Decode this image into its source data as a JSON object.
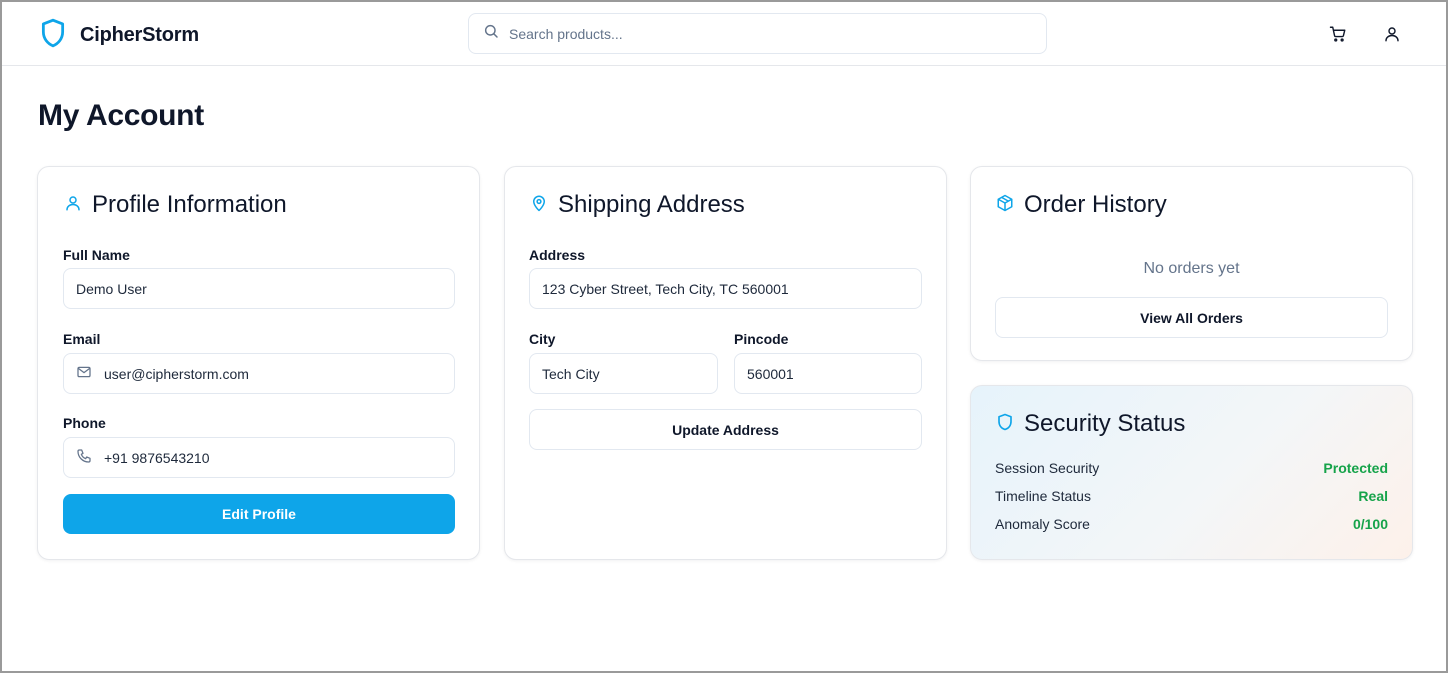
{
  "colors": {
    "accent": "#0ea5e9",
    "success": "#16a34a",
    "text": "#0f172a",
    "muted": "#64748b"
  },
  "header": {
    "brand_name": "CipherStorm",
    "brand_icon": "shield-icon",
    "search_placeholder": "Search products...",
    "cart_icon": "cart-icon",
    "user_icon": "user-icon"
  },
  "page": {
    "title": "My Account"
  },
  "profile": {
    "title": "Profile Information",
    "icon": "user-icon",
    "full_name_label": "Full Name",
    "full_name_value": "Demo User",
    "email_label": "Email",
    "email_value": "user@cipherstorm.com",
    "phone_label": "Phone",
    "phone_value": "+91 9876543210",
    "edit_button": "Edit Profile"
  },
  "shipping": {
    "title": "Shipping Address",
    "icon": "map-pin-icon",
    "address_label": "Address",
    "address_value": "123 Cyber Street, Tech City, TC 560001",
    "city_label": "City",
    "city_value": "Tech City",
    "pincode_label": "Pincode",
    "pincode_value": "560001",
    "update_button": "Update Address"
  },
  "orders": {
    "title": "Order History",
    "icon": "package-icon",
    "empty_text": "No orders yet",
    "view_all_button": "View All Orders"
  },
  "security": {
    "title": "Security Status",
    "icon": "shield-icon",
    "rows": [
      {
        "key": "Session Security",
        "value": "Protected"
      },
      {
        "key": "Timeline Status",
        "value": "Real"
      },
      {
        "key": "Anomaly Score",
        "value": "0/100"
      }
    ]
  }
}
